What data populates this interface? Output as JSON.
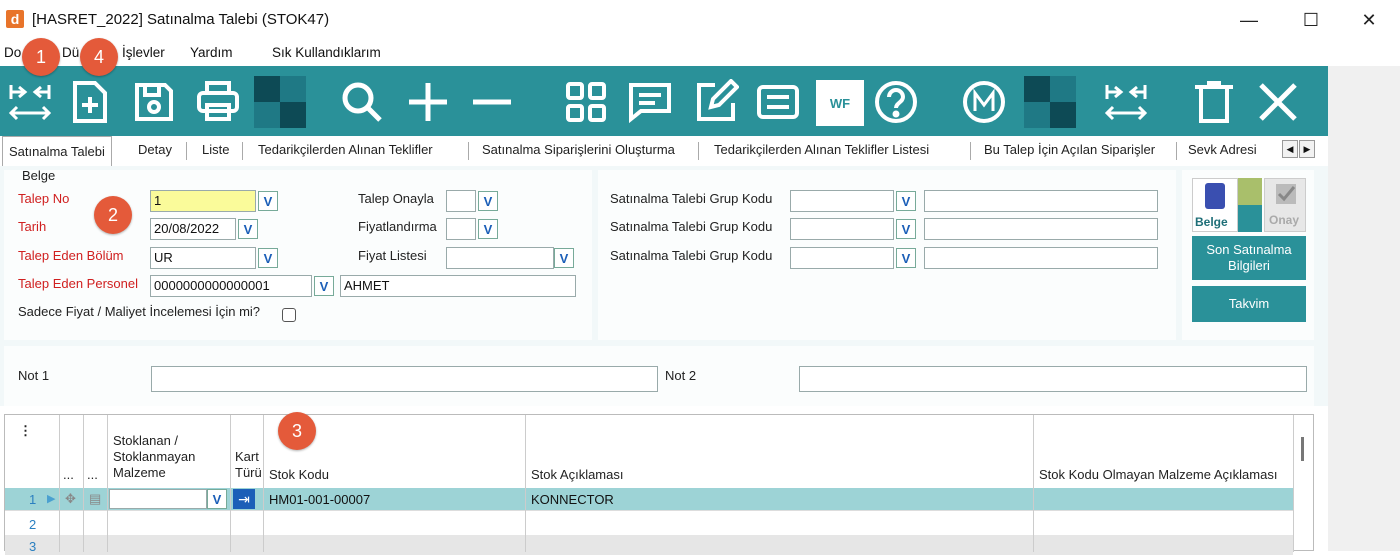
{
  "window": {
    "app_icon": "d",
    "title": "[HASRET_2022] Satınalma Talebi (STOK47)",
    "minimize": "—",
    "maximize": "☐",
    "close": "✕"
  },
  "menu": [
    "Do",
    "Dü",
    "İşlevler",
    "Yardım",
    "Sık Kullandıklarım"
  ],
  "toolbar": {
    "icons": [
      "first-last-icon",
      "new-document-icon",
      "save-icon",
      "print-icon",
      "checker-icon",
      "search-icon",
      "add-icon",
      "remove-icon",
      "grid-icon",
      "comment-icon",
      "edit-icon",
      "list-icon",
      "workflow-icon",
      "help-icon",
      "m-icon",
      "checker-icon",
      "navigate-icon",
      "delete-icon",
      "close-icon"
    ],
    "wf_label": "WF",
    "accent": "#2a9199"
  },
  "tabs": [
    "Satınalma Talebi",
    "Detay",
    "Liste",
    "Tedarikçilerden Alınan Teklifler",
    "Satınalma Siparişlerini Oluşturma",
    "Tedarikçilerden Alınan Teklifler Listesi",
    "Bu Talep İçin Açılan Siparişler",
    "Sevk Adresi"
  ],
  "form": {
    "group_label": "Belge",
    "talep_no_label": "Talep No",
    "talep_no_value": "1",
    "tarih_label": "Tarih",
    "tarih_value": "20/08/2022",
    "bolum_label": "Talep Eden Bölüm",
    "bolum_value": "UR",
    "personel_label": "Talep Eden Personel",
    "personel_code": "0000000000000001",
    "personel_name": "AHMET",
    "sadece_label": "Sadece Fiyat / Maliyet İncelemesi İçin mi?",
    "onayla_label": "Talep Onayla",
    "fiyatlandirma_label": "Fiyatlandırma",
    "fiyat_listesi_label": "Fiyat Listesi",
    "grup_kodu_label_1": "Satınalma Talebi Grup Kodu",
    "grup_kodu_label_2": "Satınalma Talebi Grup Kodu",
    "grup_kodu_label_3": "Satınalma Talebi Grup Kodu",
    "belge_icon_label": "Belge",
    "onay_icon_label": "Onay",
    "son_satinalma_label": "Son Satınalma Bilgileri",
    "takvim_label": "Takvim",
    "not1_label": "Not 1",
    "not2_label": "Not 2",
    "combo_glyph": "V"
  },
  "grid": {
    "menu_glyph": "⋮",
    "col_dots_1": "...",
    "col_dots_2": "...",
    "col_stoklanan": "Stoklanan / Stoklanmayan Malzeme",
    "col_kart": "Kart Türü",
    "col_stok_kodu": "Stok Kodu",
    "col_stok_aciklama": "Stok Açıklaması",
    "col_olmayan": "Stok Kodu Olmayan Malzeme Açıklaması",
    "rows": [
      {
        "num": "1",
        "stok_kodu": "HM01-001-00007",
        "aciklama": "KONNECTOR"
      },
      {
        "num": "2",
        "stok_kodu": "",
        "aciklama": ""
      },
      {
        "num": "3",
        "stok_kodu": "",
        "aciklama": ""
      }
    ]
  },
  "callouts": [
    "1",
    "4",
    "2",
    "3"
  ]
}
